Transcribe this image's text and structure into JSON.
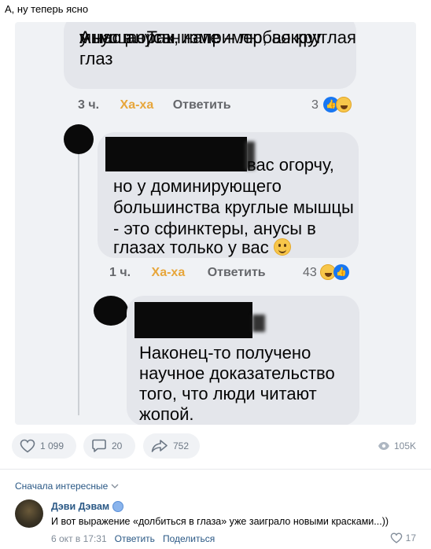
{
  "post": {
    "text": "А, ну теперь ясно"
  },
  "screenshot": {
    "comment1": {
      "lines": [
        "Анус в организме – любая круглая",
        "мышца. Так, например, вокруг глаз",
        "у нас анусы"
      ],
      "time": "3 ч.",
      "haha": "Ха-ха",
      "reply": "Ответить",
      "reactions": "3"
    },
    "comment2": {
      "lines": [
        "вас огорчу,",
        "но у доминирующего",
        "большинства круглые мышцы",
        "- это сфинктеры, анусы в",
        "глазах только у вас"
      ],
      "time": "1 ч.",
      "haha": "Ха-ха",
      "reply": "Ответить",
      "reactions": "43"
    },
    "comment3": {
      "lines": [
        "Наконец-то получено",
        "научное доказательство",
        "того, что люди читают",
        "жопой."
      ]
    }
  },
  "actions": {
    "likes": "1 099",
    "comments": "20",
    "shares": "752",
    "views": "105K"
  },
  "comments": {
    "sort_label": "Сначала интересные",
    "items": [
      {
        "author": "Дэви Дэвам",
        "text": "И вот выражение «долбиться в глаза» уже заиграло новыми красками...))",
        "date": "6 окт в 17:31",
        "reply": "Ответить",
        "share": "Поделиться",
        "likes": "17"
      }
    ]
  },
  "colors": {
    "link": "#2a5885",
    "muted": "#818c99",
    "haha": "#e7a63b",
    "bubble": "#e4e6eb"
  }
}
